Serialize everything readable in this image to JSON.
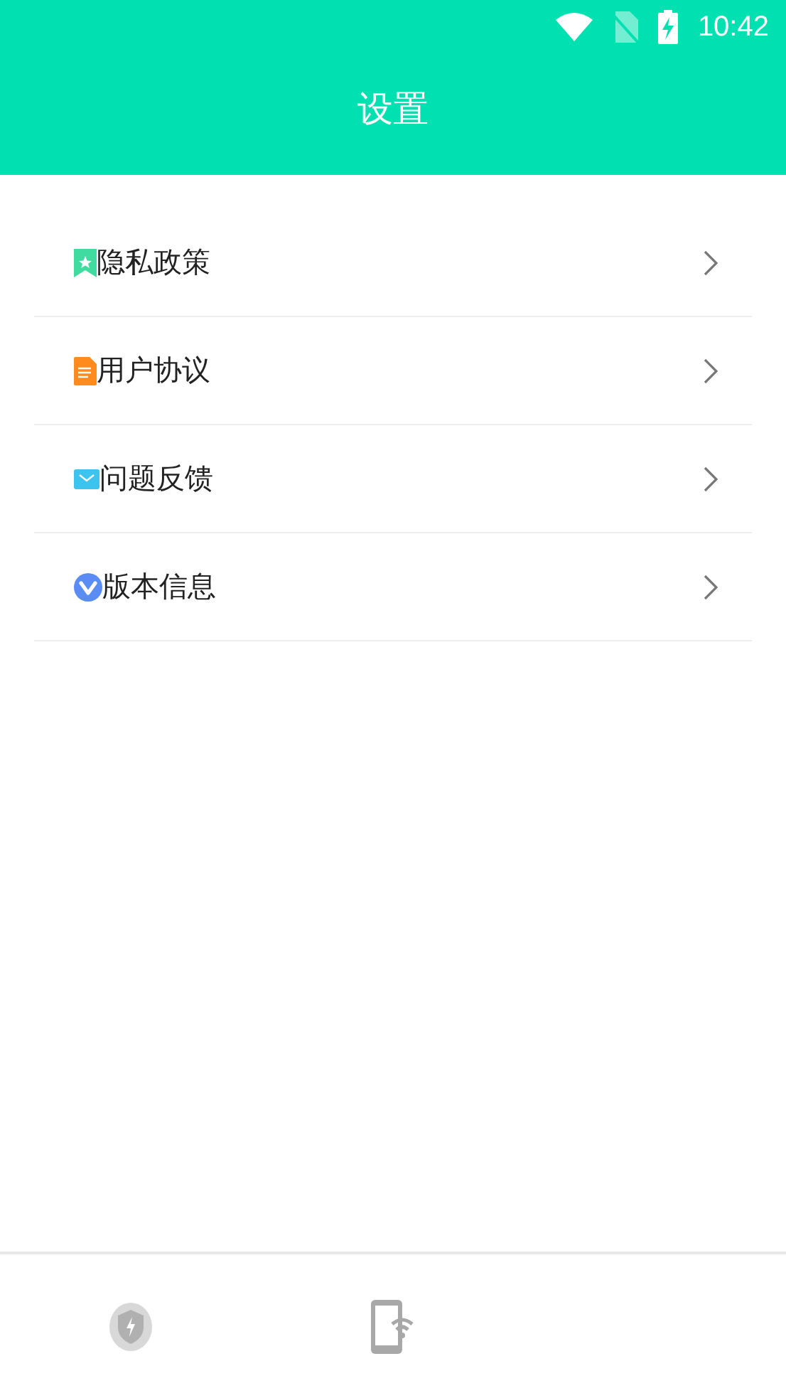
{
  "status_bar": {
    "time": "10:42"
  },
  "header": {
    "title": "设置"
  },
  "menu_items": [
    {
      "label": "隐私政策",
      "kind": "bookmark"
    },
    {
      "label": "用户协议",
      "kind": "document"
    },
    {
      "label": "问题反馈",
      "kind": "mail"
    },
    {
      "label": "版本信息",
      "kind": "version"
    }
  ]
}
